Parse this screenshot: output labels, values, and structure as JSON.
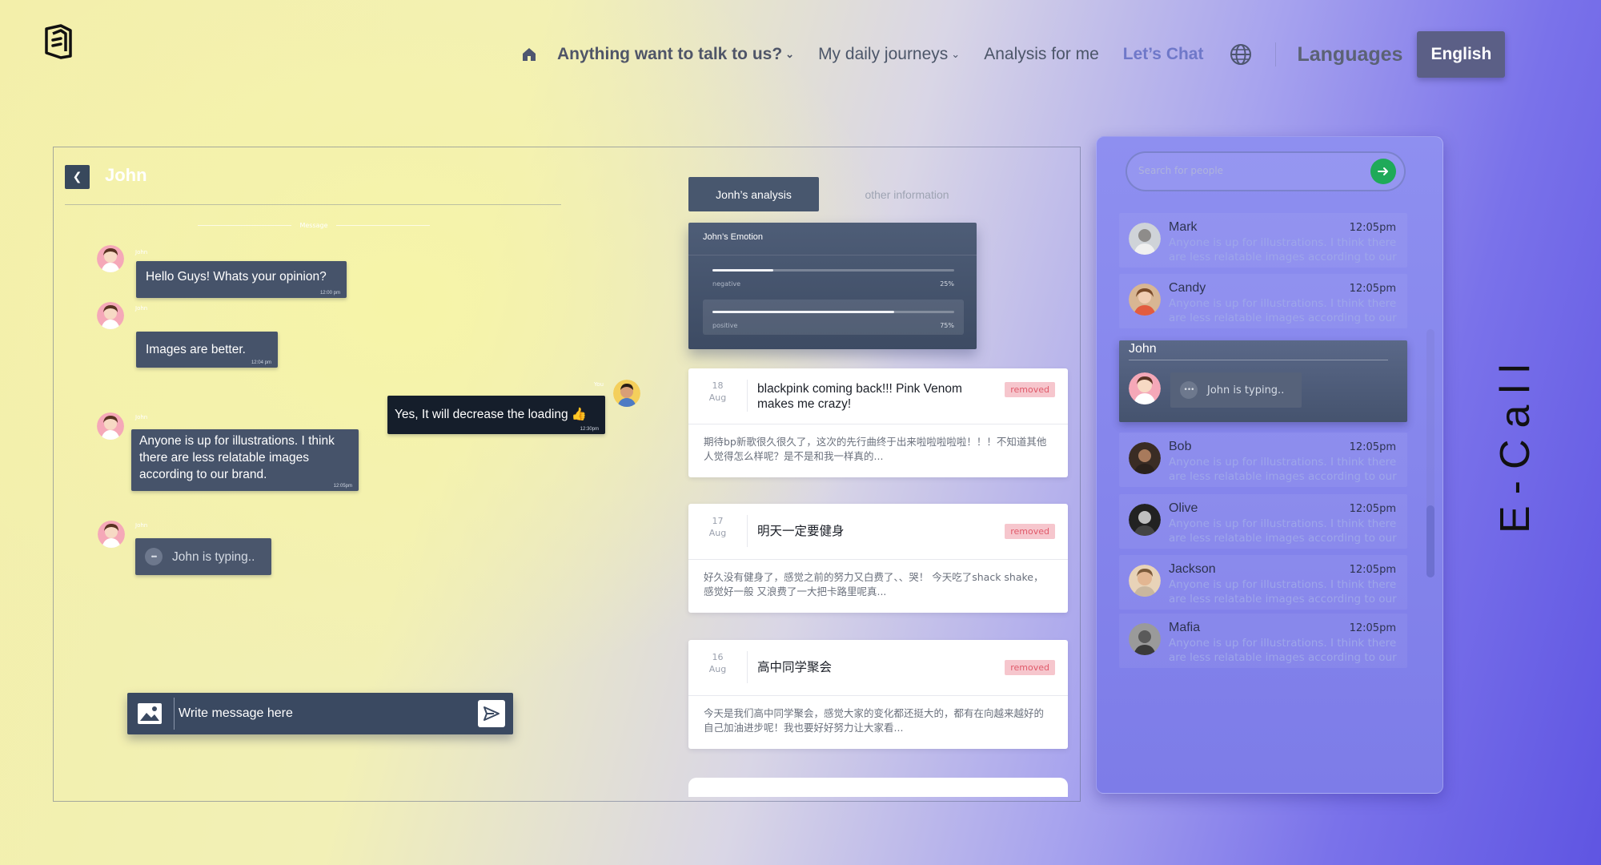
{
  "nav": {
    "items": [
      {
        "label": "Anything want to talk to us?",
        "has_dropdown": true
      },
      {
        "label": "My daily journeys",
        "has_dropdown": true
      },
      {
        "label": "Analysis for me",
        "has_dropdown": false
      },
      {
        "label": "Let’s Chat",
        "has_dropdown": false
      }
    ],
    "languages_label": "Languages",
    "language_button": "English"
  },
  "chat": {
    "contact_name": "John",
    "day_divider": "Message",
    "messages": [
      {
        "sender": "John",
        "text": "Hello Guys! Whats your opinion?",
        "time": "12:00 pm",
        "mine": false
      },
      {
        "sender": "John",
        "text": "Images are better.",
        "time": "12:04 pm",
        "mine": false
      },
      {
        "sender": "You",
        "text": "Yes, It will decrease the loading 👍",
        "time": "12:30pm",
        "mine": true
      },
      {
        "sender": "John",
        "text": "Anyone is up for illustrations. I think there are less relatable images according to our brand.",
        "time": "12:05pm",
        "mine": false
      },
      {
        "sender": "John",
        "text": "John is typing..",
        "time": "",
        "mine": false,
        "typing": true
      }
    ],
    "composer_placeholder": "Write message here"
  },
  "analysis": {
    "tabs": [
      {
        "label": "Jonh’s analysis",
        "active": true
      },
      {
        "label": "other information",
        "active": false
      }
    ],
    "emotion": {
      "title": "John’s Emotion",
      "rows": [
        {
          "label": "negative",
          "value": 25,
          "display": "25%"
        },
        {
          "label": "positive",
          "value": 75,
          "display": "75%"
        }
      ]
    },
    "entries": [
      {
        "day": "18",
        "month": "Aug",
        "title": "blackpink coming back!!! Pink Venom makes me crazy!",
        "badge": "removed",
        "body": "期待bp新歌很久很久了，这次的先行曲终于出来啦啦啦啦啦！！！不知道其他人觉得怎么样呢？是不是和我一样真的..."
      },
      {
        "day": "17",
        "month": "Aug",
        "title": "明天一定要健身",
        "badge": "removed",
        "body": "好久没有健身了，感觉之前的努力又白费了、、哭！ 今天吃了shack shake， 感觉好一般 又浪费了一大把卡路里呢真..."
      },
      {
        "day": "16",
        "month": "Aug",
        "title": "高中同学聚会",
        "badge": "removed",
        "body": "今天是我们高中同学聚会，感觉大家的变化都还挺大的，都有在向越来越好的自己加油进步呢！我也要好好努力让大家看..."
      }
    ]
  },
  "contacts": {
    "search_placeholder": "Search for people",
    "list": [
      {
        "name": "Mark",
        "time": "12:05pm",
        "message": "Anyone is up for illustrations. I think there are less relatable images according to our brand."
      },
      {
        "name": "Candy",
        "time": "12:05pm",
        "message": "Anyone is up for illustrations. I think there are less relatable images according to our brand."
      },
      {
        "name": "John",
        "active": true,
        "typing": "John is typing.."
      },
      {
        "name": "Bob",
        "time": "12:05pm",
        "message": "Anyone is up for illustrations. I think there are less relatable images according to our brand."
      },
      {
        "name": "Olive",
        "time": "12:05pm",
        "message": "Anyone is up for illustrations. I think there are less relatable images according to our brand."
      },
      {
        "name": "Jackson",
        "time": "12:05pm",
        "message": "Anyone is up for illustrations. I think there are less relatable images according to our brand."
      },
      {
        "name": "Mafia",
        "time": "12:05pm",
        "message": "Anyone is up for illustrations. I think there are less relatable images according to our brand."
      }
    ]
  },
  "brand_vertical": "E-Call",
  "colors": {
    "accent": "#5b5f86",
    "bubble": "#46536a",
    "bubble_mine": "#151e2b",
    "badge_bg": "#f6c6cd",
    "badge_text": "#e05a6a",
    "send_go": "#1faa59"
  }
}
